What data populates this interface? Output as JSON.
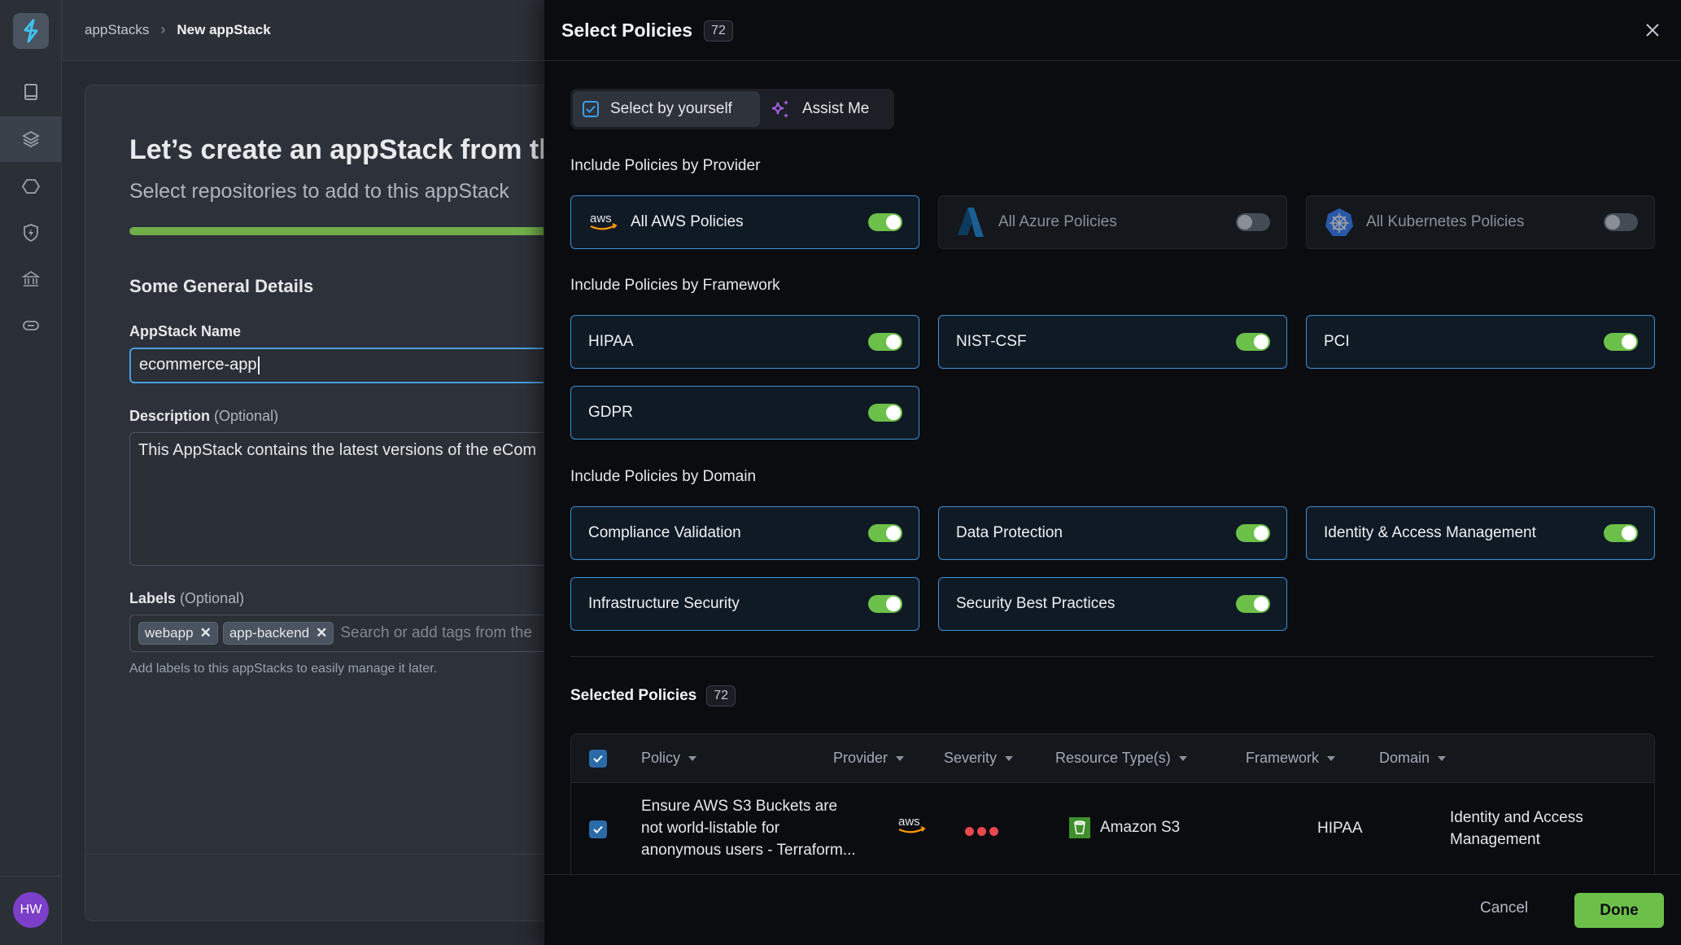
{
  "app": {
    "breadcrumb": {
      "parent": "appStacks",
      "separator": "›",
      "current": "New appStack"
    },
    "user_initials": "HW",
    "nav": [
      "repositories-icon",
      "appstacks-icon",
      "hexagon-icon",
      "shield-bolt-icon",
      "bank-icon",
      "link-icon"
    ]
  },
  "page": {
    "title": "Let’s create an appStack from th",
    "subtitle": "Select repositories to add to this appStack",
    "progress_percent": 100,
    "section_title": "Some General Details",
    "name_label": "AppStack Name",
    "name_value": "ecommerce-app",
    "description_label": "Description",
    "optional": "(Optional)",
    "description_value": "This AppStack contains the latest versions of the eCom",
    "labels_label": "Labels",
    "tags": [
      "webapp",
      "app-backend"
    ],
    "tags_placeholder": "Search or add tags from the",
    "labels_hint": "Add labels to this appStacks to easily manage it later."
  },
  "dialog": {
    "title": "Select Policies",
    "count": "72",
    "modes": {
      "self": "Select by yourself",
      "assist": "Assist Me"
    },
    "provider_section": "Include Policies by Provider",
    "providers": [
      {
        "label": "All AWS Policies",
        "on": true
      },
      {
        "label": "All Azure Policies",
        "on": false
      },
      {
        "label": "All Kubernetes Policies",
        "on": false
      }
    ],
    "framework_section": "Include Policies by Framework",
    "frameworks": [
      {
        "label": "HIPAA",
        "on": true
      },
      {
        "label": "NIST-CSF",
        "on": true
      },
      {
        "label": "PCI",
        "on": true
      },
      {
        "label": "GDPR",
        "on": true
      }
    ],
    "domain_section": "Include Policies by Domain",
    "domains": [
      {
        "label": "Compliance Validation",
        "on": true
      },
      {
        "label": "Data Protection",
        "on": true
      },
      {
        "label": "Identity & Access Management",
        "on": true
      },
      {
        "label": "Infrastructure Security",
        "on": true
      },
      {
        "label": "Security Best Practices",
        "on": true
      }
    ],
    "selected_title": "Selected Policies",
    "selected_count": "72",
    "columns": [
      "Policy",
      "Provider",
      "Severity",
      "Resource Type(s)",
      "Framework",
      "Domain"
    ],
    "rows": [
      {
        "policy": "Ensure AWS S3 Buckets are not world-listable for anonymous users - Terraform...",
        "policy_lines": [
          "Ensure AWS S3 Buckets are",
          "not world-listable for",
          "anonymous users - Terraform..."
        ],
        "provider": "aws",
        "severity": "high",
        "resource_type": "Amazon S3",
        "framework": "HIPAA",
        "domain_lines": [
          "Identity and Access",
          "Management"
        ]
      }
    ],
    "cancel": "Cancel",
    "done": "Done"
  }
}
